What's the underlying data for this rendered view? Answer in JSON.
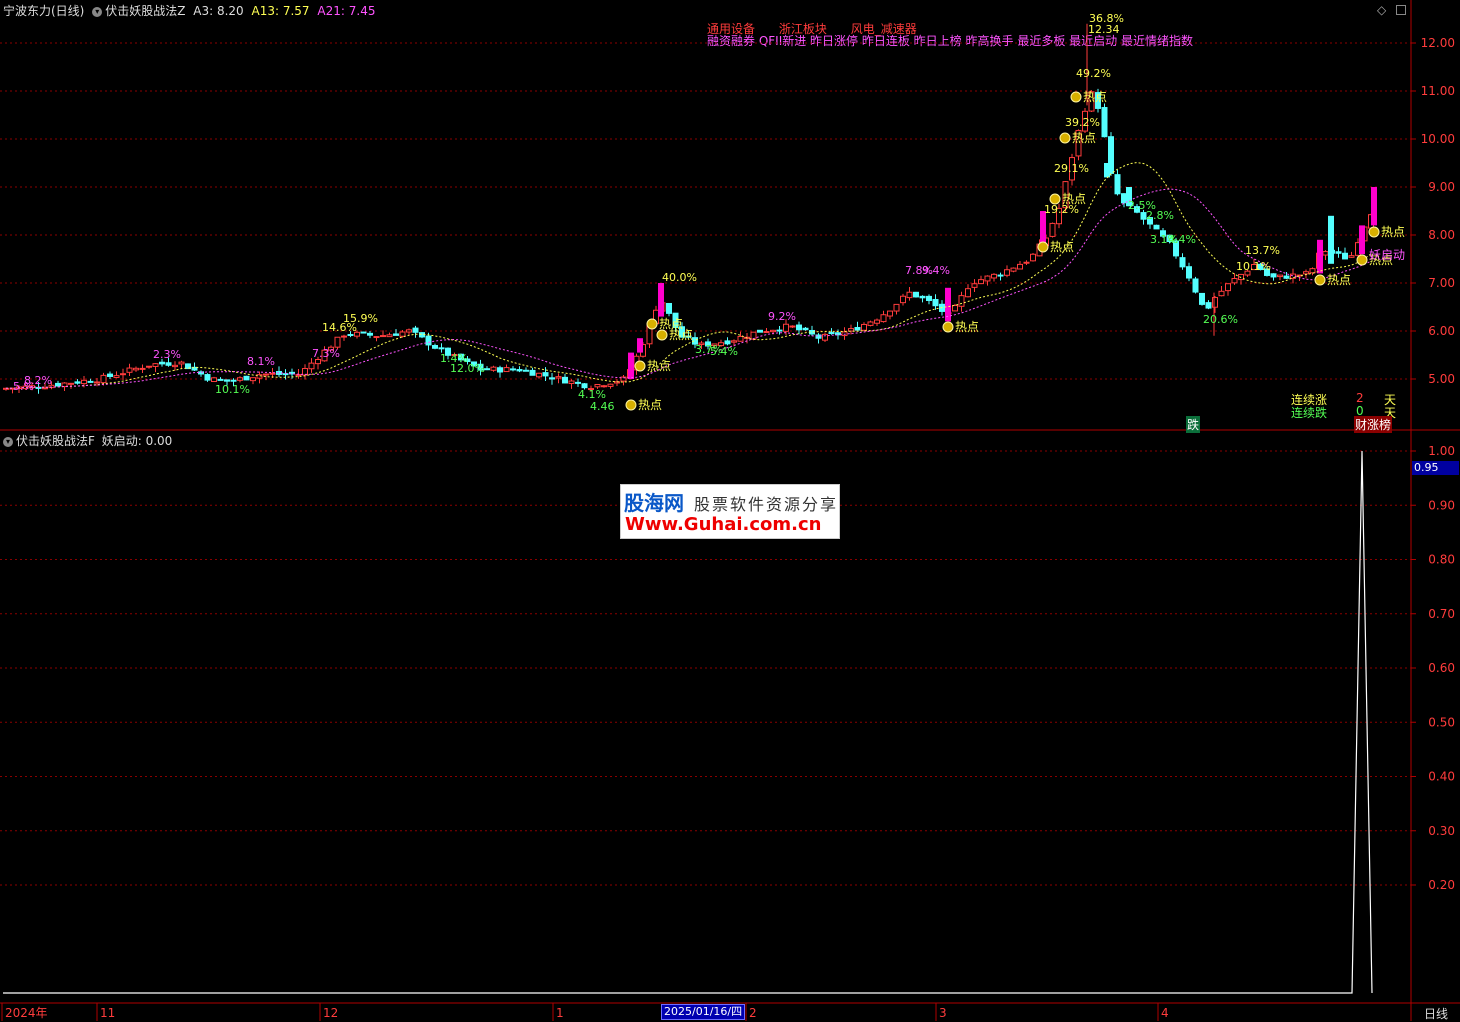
{
  "header": {
    "stock_title": "宁波东力(日线)",
    "indicator_name": "伏击妖股战法Z",
    "a3_label": "A3: 8.20",
    "a13_label": "A13: 7.57",
    "a21_label": "A21: 7.45"
  },
  "sub_header": {
    "indicator_name": "伏击妖股战法F",
    "value_label": "妖启动: 0.00"
  },
  "concepts": {
    "row1": [
      "通用设备",
      "浙江板块",
      "风电_减速器"
    ],
    "row2": "融资融券 QFII新进 昨日涨停 昨日连板 昨日上榜 昨高换手 最近多板 最近启动 最近情绪指数"
  },
  "price_axis": [
    "12.00",
    "11.00",
    "10.00",
    "9.00",
    "8.00",
    "7.00",
    "6.00",
    "5.00"
  ],
  "indicator_axis": [
    "1.00",
    "0.90",
    "0.80",
    "0.70",
    "0.60",
    "0.50",
    "0.40",
    "0.30",
    "0.20"
  ],
  "indicator_cursor_value": "0.95",
  "date_axis": [
    "2024年",
    "11",
    "12",
    "1",
    "2",
    "3",
    "4"
  ],
  "date_cursor": "2025/01/16/四",
  "period_label": "日线",
  "stats": {
    "up_label": "连续涨",
    "up_value": "2",
    "up_unit": "天",
    "down_label": "连续跌",
    "down_value": "0",
    "down_unit": "天",
    "fall_tag": "跌",
    "rank_tag": "财涨榜"
  },
  "hot_label": "热点",
  "start_label": "妖启动",
  "high_price_label": "12.34",
  "low_price_label": "4.46",
  "watermark": {
    "brand": "股海网",
    "slogan": "股票软件资源分享",
    "url": "Www.Guhai.com.cn"
  },
  "annotations_pct": [
    "8.2%",
    "5.%",
    "2.3%",
    "8.1%",
    "10.1%",
    "7.3%",
    "14.6%",
    "15.9%",
    "1.4%",
    "12.0%",
    "4.1%",
    "40.0%",
    "3.7%",
    "5.4%",
    "9.2%",
    "7.8%",
    "9.4%",
    "29.1%",
    "19.2%",
    "39.2%",
    "49.2%",
    "2.5%",
    "2.8%",
    "3.1%",
    "4.4%",
    "13.7%",
    "10.1%",
    "20.6%"
  ],
  "colors": {
    "up": "#ff3c3c",
    "down": "#54ffff",
    "ma_short": "#ffff54",
    "ma_long": "#ff54ff",
    "grid": "#8b0000",
    "hot_bar": "#ff00cc"
  }
}
